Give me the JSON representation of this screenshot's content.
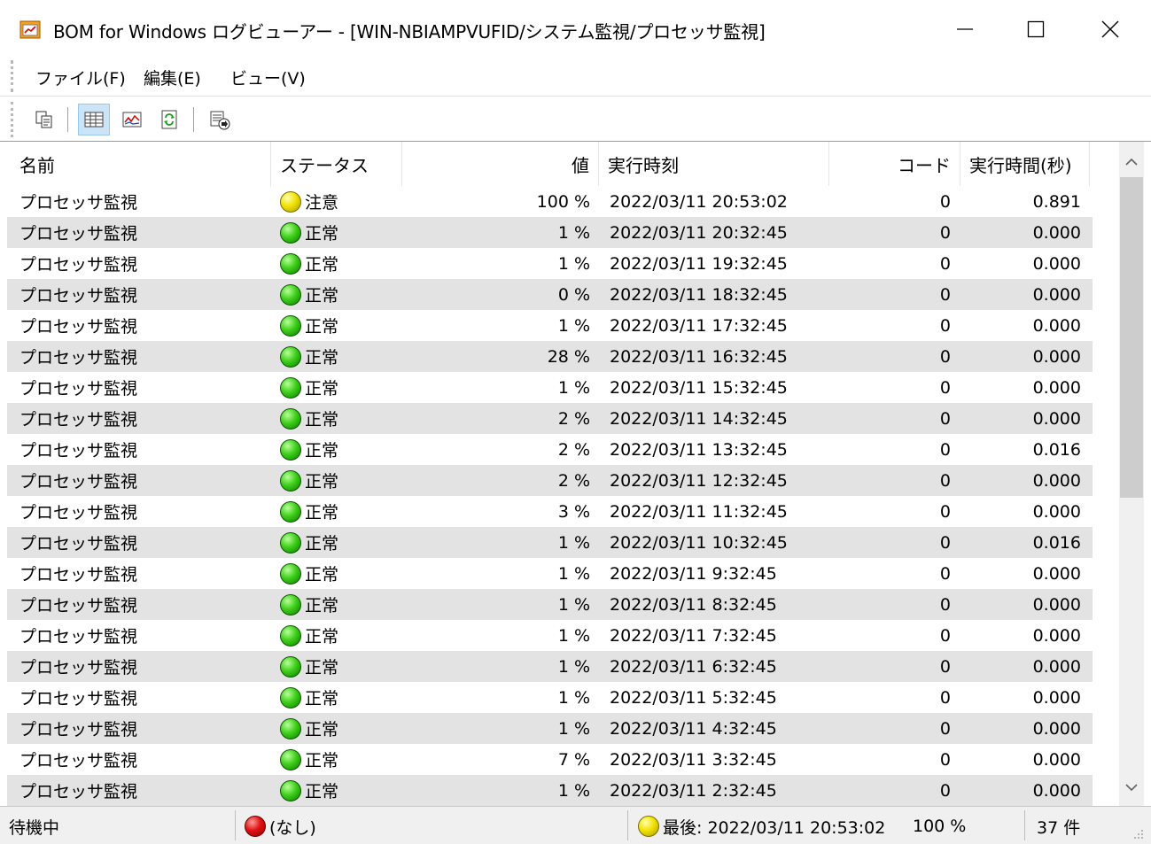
{
  "window": {
    "title": "BOM for Windows ログビューアー - [WIN-NBIAMPVUFID/システム監視/プロセッサ監視]"
  },
  "menu": {
    "file": "ファイル(F)",
    "edit": "編集(E)",
    "view": "ビュー(V)"
  },
  "columns": {
    "name": "名前",
    "status": "ステータス",
    "value": "値",
    "time": "実行時刻",
    "code": "コード",
    "duration": "実行時間(秒)"
  },
  "rows": [
    {
      "name": "プロセッサ監視",
      "status": "注意",
      "value": "100 %",
      "time": "2022/03/11 20:53:02",
      "code": "0",
      "duration": "0.891"
    },
    {
      "name": "プロセッサ監視",
      "status": "正常",
      "value": "1 %",
      "time": "2022/03/11 20:32:45",
      "code": "0",
      "duration": "0.000"
    },
    {
      "name": "プロセッサ監視",
      "status": "正常",
      "value": "1 %",
      "time": "2022/03/11 19:32:45",
      "code": "0",
      "duration": "0.000"
    },
    {
      "name": "プロセッサ監視",
      "status": "正常",
      "value": "0 %",
      "time": "2022/03/11 18:32:45",
      "code": "0",
      "duration": "0.000"
    },
    {
      "name": "プロセッサ監視",
      "status": "正常",
      "value": "1 %",
      "time": "2022/03/11 17:32:45",
      "code": "0",
      "duration": "0.000"
    },
    {
      "name": "プロセッサ監視",
      "status": "正常",
      "value": "28 %",
      "time": "2022/03/11 16:32:45",
      "code": "0",
      "duration": "0.000"
    },
    {
      "name": "プロセッサ監視",
      "status": "正常",
      "value": "1 %",
      "time": "2022/03/11 15:32:45",
      "code": "0",
      "duration": "0.000"
    },
    {
      "name": "プロセッサ監視",
      "status": "正常",
      "value": "2 %",
      "time": "2022/03/11 14:32:45",
      "code": "0",
      "duration": "0.000"
    },
    {
      "name": "プロセッサ監視",
      "status": "正常",
      "value": "2 %",
      "time": "2022/03/11 13:32:45",
      "code": "0",
      "duration": "0.016"
    },
    {
      "name": "プロセッサ監視",
      "status": "正常",
      "value": "2 %",
      "time": "2022/03/11 12:32:45",
      "code": "0",
      "duration": "0.000"
    },
    {
      "name": "プロセッサ監視",
      "status": "正常",
      "value": "3 %",
      "time": "2022/03/11 11:32:45",
      "code": "0",
      "duration": "0.000"
    },
    {
      "name": "プロセッサ監視",
      "status": "正常",
      "value": "1 %",
      "time": "2022/03/11 10:32:45",
      "code": "0",
      "duration": "0.016"
    },
    {
      "name": "プロセッサ監視",
      "status": "正常",
      "value": "1 %",
      "time": "2022/03/11 9:32:45",
      "code": "0",
      "duration": "0.000"
    },
    {
      "name": "プロセッサ監視",
      "status": "正常",
      "value": "1 %",
      "time": "2022/03/11 8:32:45",
      "code": "0",
      "duration": "0.000"
    },
    {
      "name": "プロセッサ監視",
      "status": "正常",
      "value": "1 %",
      "time": "2022/03/11 7:32:45",
      "code": "0",
      "duration": "0.000"
    },
    {
      "name": "プロセッサ監視",
      "status": "正常",
      "value": "1 %",
      "time": "2022/03/11 6:32:45",
      "code": "0",
      "duration": "0.000"
    },
    {
      "name": "プロセッサ監視",
      "status": "正常",
      "value": "1 %",
      "time": "2022/03/11 5:32:45",
      "code": "0",
      "duration": "0.000"
    },
    {
      "name": "プロセッサ監視",
      "status": "正常",
      "value": "1 %",
      "time": "2022/03/11 4:32:45",
      "code": "0",
      "duration": "0.000"
    },
    {
      "name": "プロセッサ監視",
      "status": "正常",
      "value": "7 %",
      "time": "2022/03/11 3:32:45",
      "code": "0",
      "duration": "0.000"
    },
    {
      "name": "プロセッサ監視",
      "status": "正常",
      "value": "1 %",
      "time": "2022/03/11 2:32:45",
      "code": "0",
      "duration": "0.000"
    }
  ],
  "status_colors": {
    "正常": "green",
    "注意": "yellow"
  },
  "statusbar": {
    "state": "待機中",
    "alert": "(なし)",
    "last": "最後: 2022/03/11 20:53:02",
    "last_value": "100 %",
    "count": "37 件"
  },
  "scroll": {
    "thumb_start_fraction": 0.0,
    "thumb_length_fraction": 0.54
  }
}
